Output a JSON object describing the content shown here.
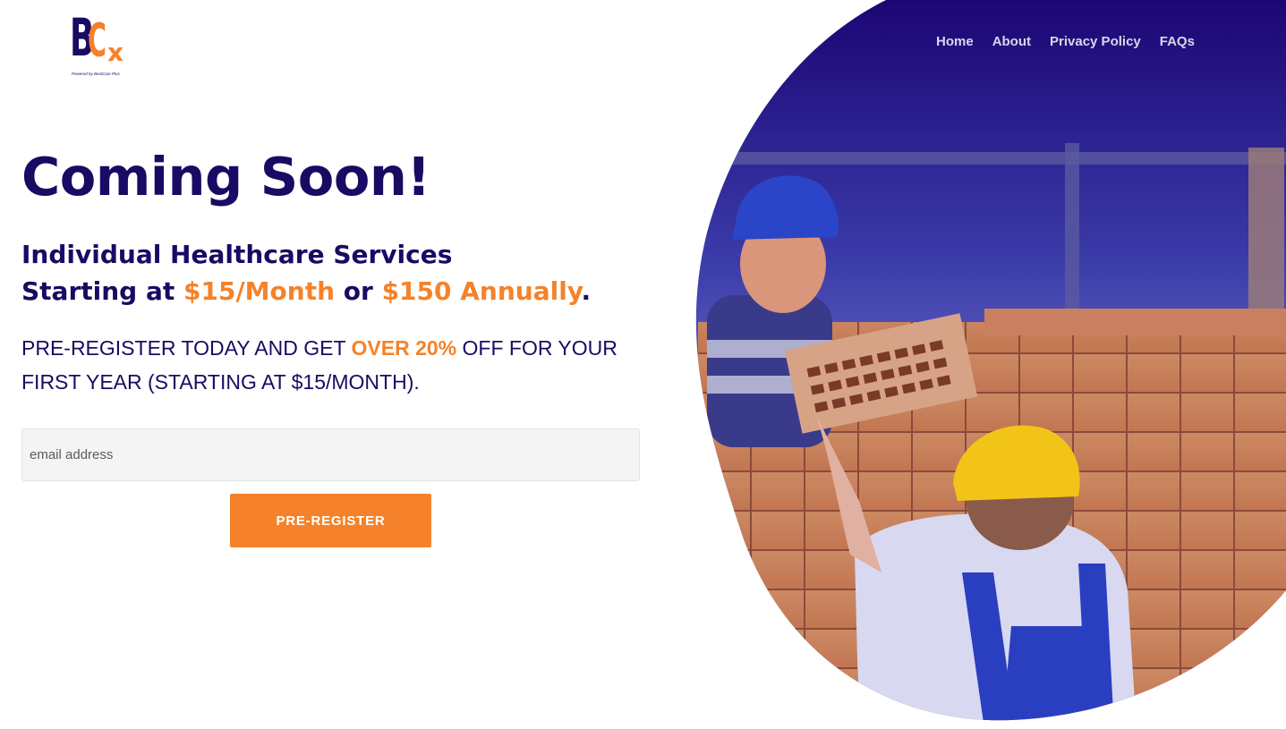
{
  "brand": {
    "logo_letters": [
      "B",
      "C",
      "x"
    ],
    "logo_tagline": "Powered by BestCare Plus",
    "colors": {
      "navy": "#1a0a63",
      "orange": "#f5822a"
    }
  },
  "nav": {
    "items": [
      {
        "label": "Home"
      },
      {
        "label": "About"
      },
      {
        "label": "Privacy Policy"
      },
      {
        "label": "FAQs"
      }
    ]
  },
  "hero": {
    "title": "Coming Soon!",
    "subtitle_line1": "Individual Healthcare Services",
    "subtitle_prefix": "Starting at ",
    "price_monthly": "$15/Month",
    "subtitle_or": " or ",
    "price_annual": "$150 Annually",
    "subtitle_end": ".",
    "promo_prefix": "PRE-REGISTER TODAY AND GET ",
    "promo_highlight": "OVER 20%",
    "promo_suffix": " OFF FOR YOUR FIRST YEAR (STARTING AT $15/MONTH).",
    "image_icon": "construction-workers-photo"
  },
  "form": {
    "email_placeholder": "email address",
    "email_value": "",
    "submit_label": "PRE-REGISTER"
  }
}
